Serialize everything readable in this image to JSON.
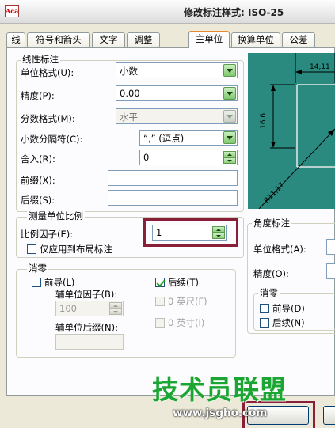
{
  "window": {
    "title": "修改标注样式: ISO-25",
    "app_icon_text": "Aca"
  },
  "tabs": [
    {
      "label": "线"
    },
    {
      "label": "符号和箭头"
    },
    {
      "label": "文字"
    },
    {
      "label": "调整"
    },
    {
      "label": "主单位",
      "active": true
    },
    {
      "label": "换算单位"
    },
    {
      "label": "公差"
    }
  ],
  "linear": {
    "group_label": "线性标注",
    "unit_format": {
      "label": "单位格式(U):",
      "value": "小数"
    },
    "precision": {
      "label": "精度(P):",
      "value": "0.00"
    },
    "fraction_format": {
      "label": "分数格式(M):",
      "value": "水平"
    },
    "decimal_separator": {
      "label": "小数分隔符(C):",
      "value": "“,” (逗点)"
    },
    "round_off": {
      "label": "舍入(R):",
      "value": "0"
    },
    "prefix": {
      "label": "前缀(X):",
      "value": ""
    },
    "suffix": {
      "label": "后缀(S):",
      "value": ""
    }
  },
  "measurement_scale": {
    "group_label": "测量单位比例",
    "scale_factor": {
      "label": "比例因子(E):",
      "value": "1"
    },
    "layout_only": {
      "label": "仅应用到布局标注",
      "checked": false
    }
  },
  "zero_suppression": {
    "group_label": "消零",
    "leading": {
      "label": "前导(L)",
      "checked": false
    },
    "trailing": {
      "label": "后续(T)",
      "checked": true
    },
    "sub_unit_factor": {
      "label": "辅单位因子(B):",
      "value": "100"
    },
    "sub_unit_suffix": {
      "label": "辅单位后缀(N):",
      "value": ""
    },
    "zero_feet": {
      "label": "0 英尺(F)",
      "checked": false
    },
    "zero_inches": {
      "label": "0 英寸(I)",
      "checked": false
    }
  },
  "angular": {
    "group_label": "角度标注",
    "unit_format": {
      "label": "单位格式(A):"
    },
    "precision": {
      "label": "精度(O):"
    },
    "zero_group_label": "消零",
    "leading": {
      "label": "前导(D)",
      "checked": false
    },
    "trailing": {
      "label": "后续(N)",
      "checked": false
    }
  },
  "preview": {
    "dim_top": "14,11",
    "dim_left": "16,6",
    "dim_radius": "R11,17"
  },
  "watermark": {
    "brand": "技术员联盟",
    "url": "www.jsgho.com"
  },
  "colors": {
    "preview_bg": "#2b8a80",
    "highlight": "#8a1f3a",
    "watermark": "#1ba533"
  }
}
